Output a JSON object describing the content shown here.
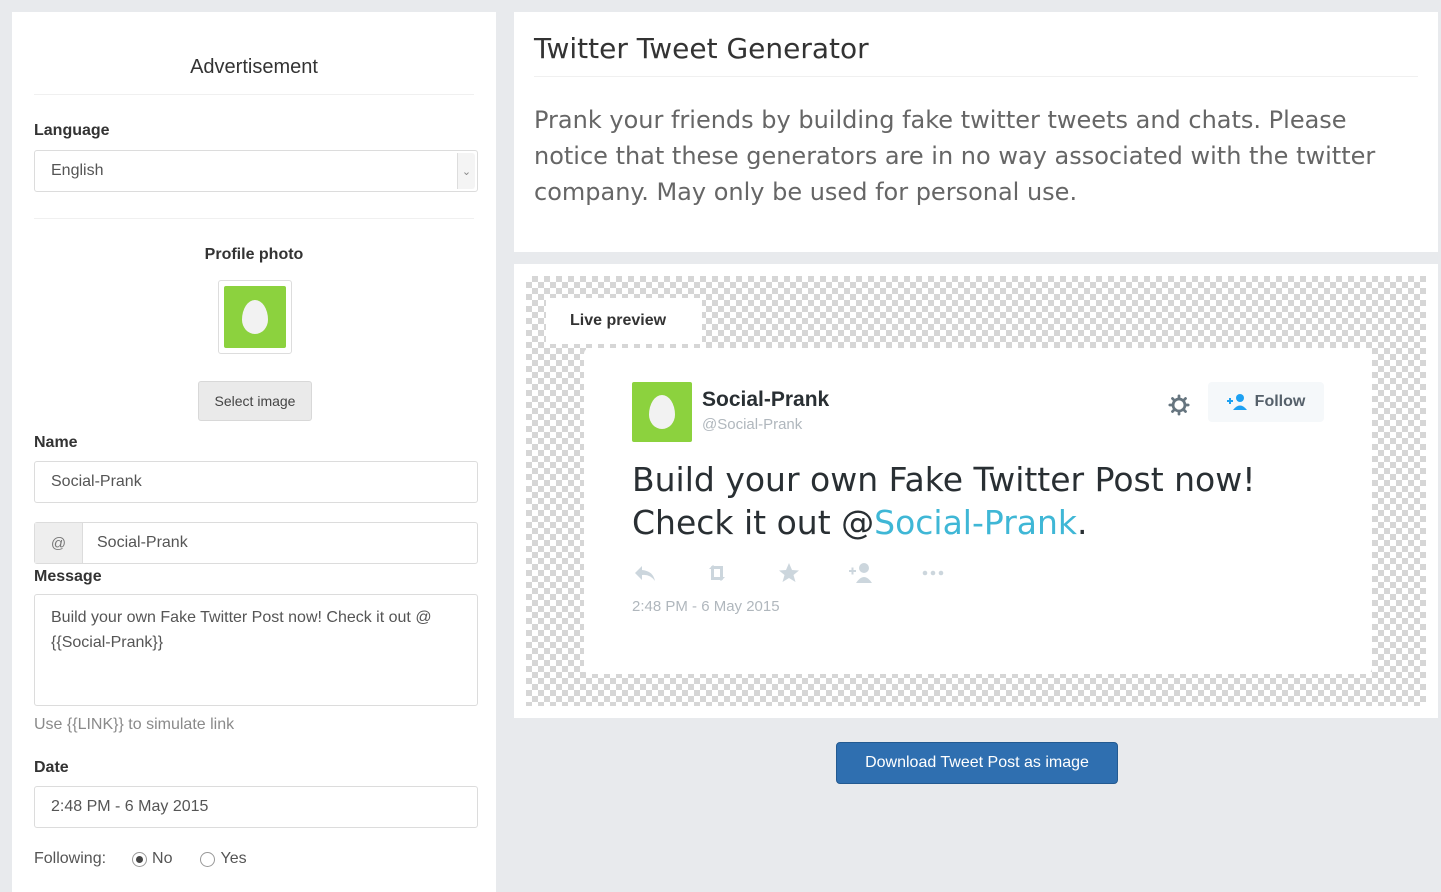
{
  "sidebar": {
    "advertisement": "Advertisement",
    "language_label": "Language",
    "language_value": "English",
    "profile_photo_label": "Profile photo",
    "select_image_label": "Select image",
    "name_label": "Name",
    "name_value": "Social-Prank",
    "handle_prefix": "@",
    "handle_value": "Social-Prank",
    "message_label": "Message",
    "message_value": "Build your own Fake Twitter Post now! Check it out @ {{Social-Prank}}",
    "message_help": "Use {{LINK}} to simulate link",
    "date_label": "Date",
    "date_value": "2:48 PM - 6 May 2015",
    "following_label": "Following:",
    "following_options": [
      "No",
      "Yes"
    ],
    "following_selected": "No"
  },
  "header": {
    "title": "Twitter Tweet Generator",
    "intro": "Prank your friends by building fake twitter tweets and chats. Please notice that these generators are in no way associated with the twitter company. May only be used for personal use."
  },
  "preview": {
    "tab_label": "Live preview",
    "tweet": {
      "name": "Social-Prank",
      "handle": "@Social-Prank",
      "follow_label": "Follow",
      "text_line1": "Build your own Fake Twitter Post now!",
      "text_line2_prefix": "Check it out  @",
      "text_link": "Social-Prank",
      "text_suffix": ".",
      "date": "2:48 PM - 6 May 2015"
    },
    "download_label": "Download Tweet Post as image"
  },
  "colors": {
    "avatar_green": "#8cd23e",
    "link_blue": "#3fb7d6",
    "primary_button": "#2f6fb0"
  },
  "icons": [
    "chevron-down-icon",
    "egg-avatar-icon",
    "gear-icon",
    "follow-user-icon",
    "reply-icon",
    "retweet-icon",
    "favorite-star-icon",
    "follow-plus-icon",
    "more-dots-icon"
  ]
}
